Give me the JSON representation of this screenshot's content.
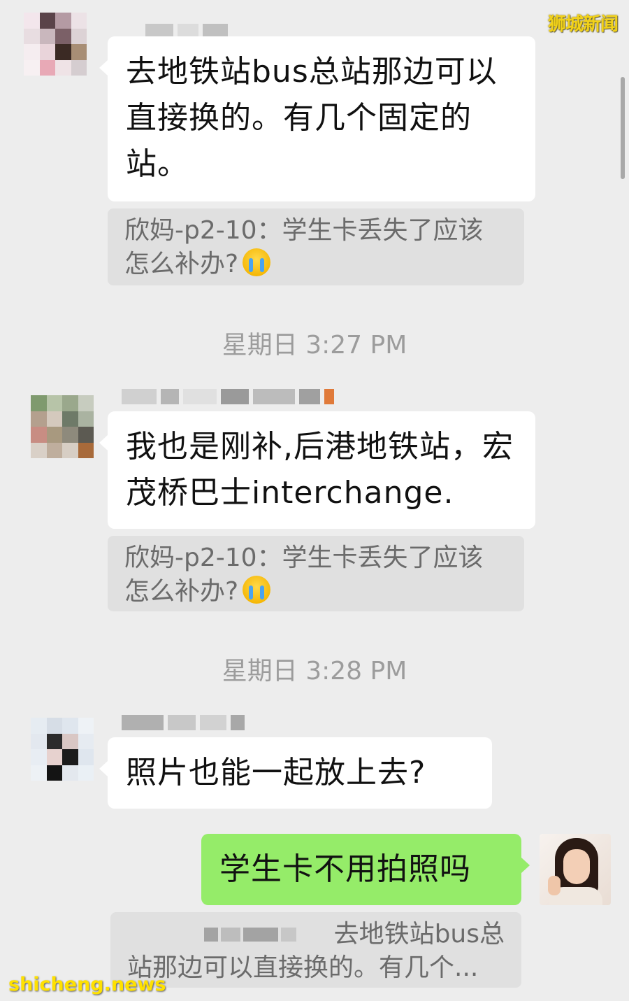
{
  "watermarks": {
    "top_right": "狮城新闻",
    "bottom_left": "shicheng.news"
  },
  "messages": [
    {
      "text": "去地铁站bus总站那边可以直接换的。有几个固定的站。",
      "quote": "欣妈-p2-10：学生卡丢失了应该怎么补办?"
    },
    {
      "timestamp": "星期日 3:27 PM",
      "text": "我也是刚补,后港地铁站，宏茂桥巴士interchange.",
      "quote": "欣妈-p2-10：学生卡丢失了应该怎么补办?"
    },
    {
      "timestamp": "星期日 3:28 PM",
      "text": "照片也能一起放上去?"
    },
    {
      "text": "学生卡不用拍照吗",
      "quote_line1": "去地铁站bus总",
      "quote_line2": "站那边可以直接换的。有几个..."
    }
  ],
  "colors": {
    "background": "#ededed",
    "bubble_incoming": "#ffffff",
    "bubble_outgoing": "#95ec69",
    "quote_bg": "#e0e0e0",
    "timestamp_text": "#9c9c9c"
  },
  "icons": {
    "crying_emoji": "loudly-crying-face"
  }
}
